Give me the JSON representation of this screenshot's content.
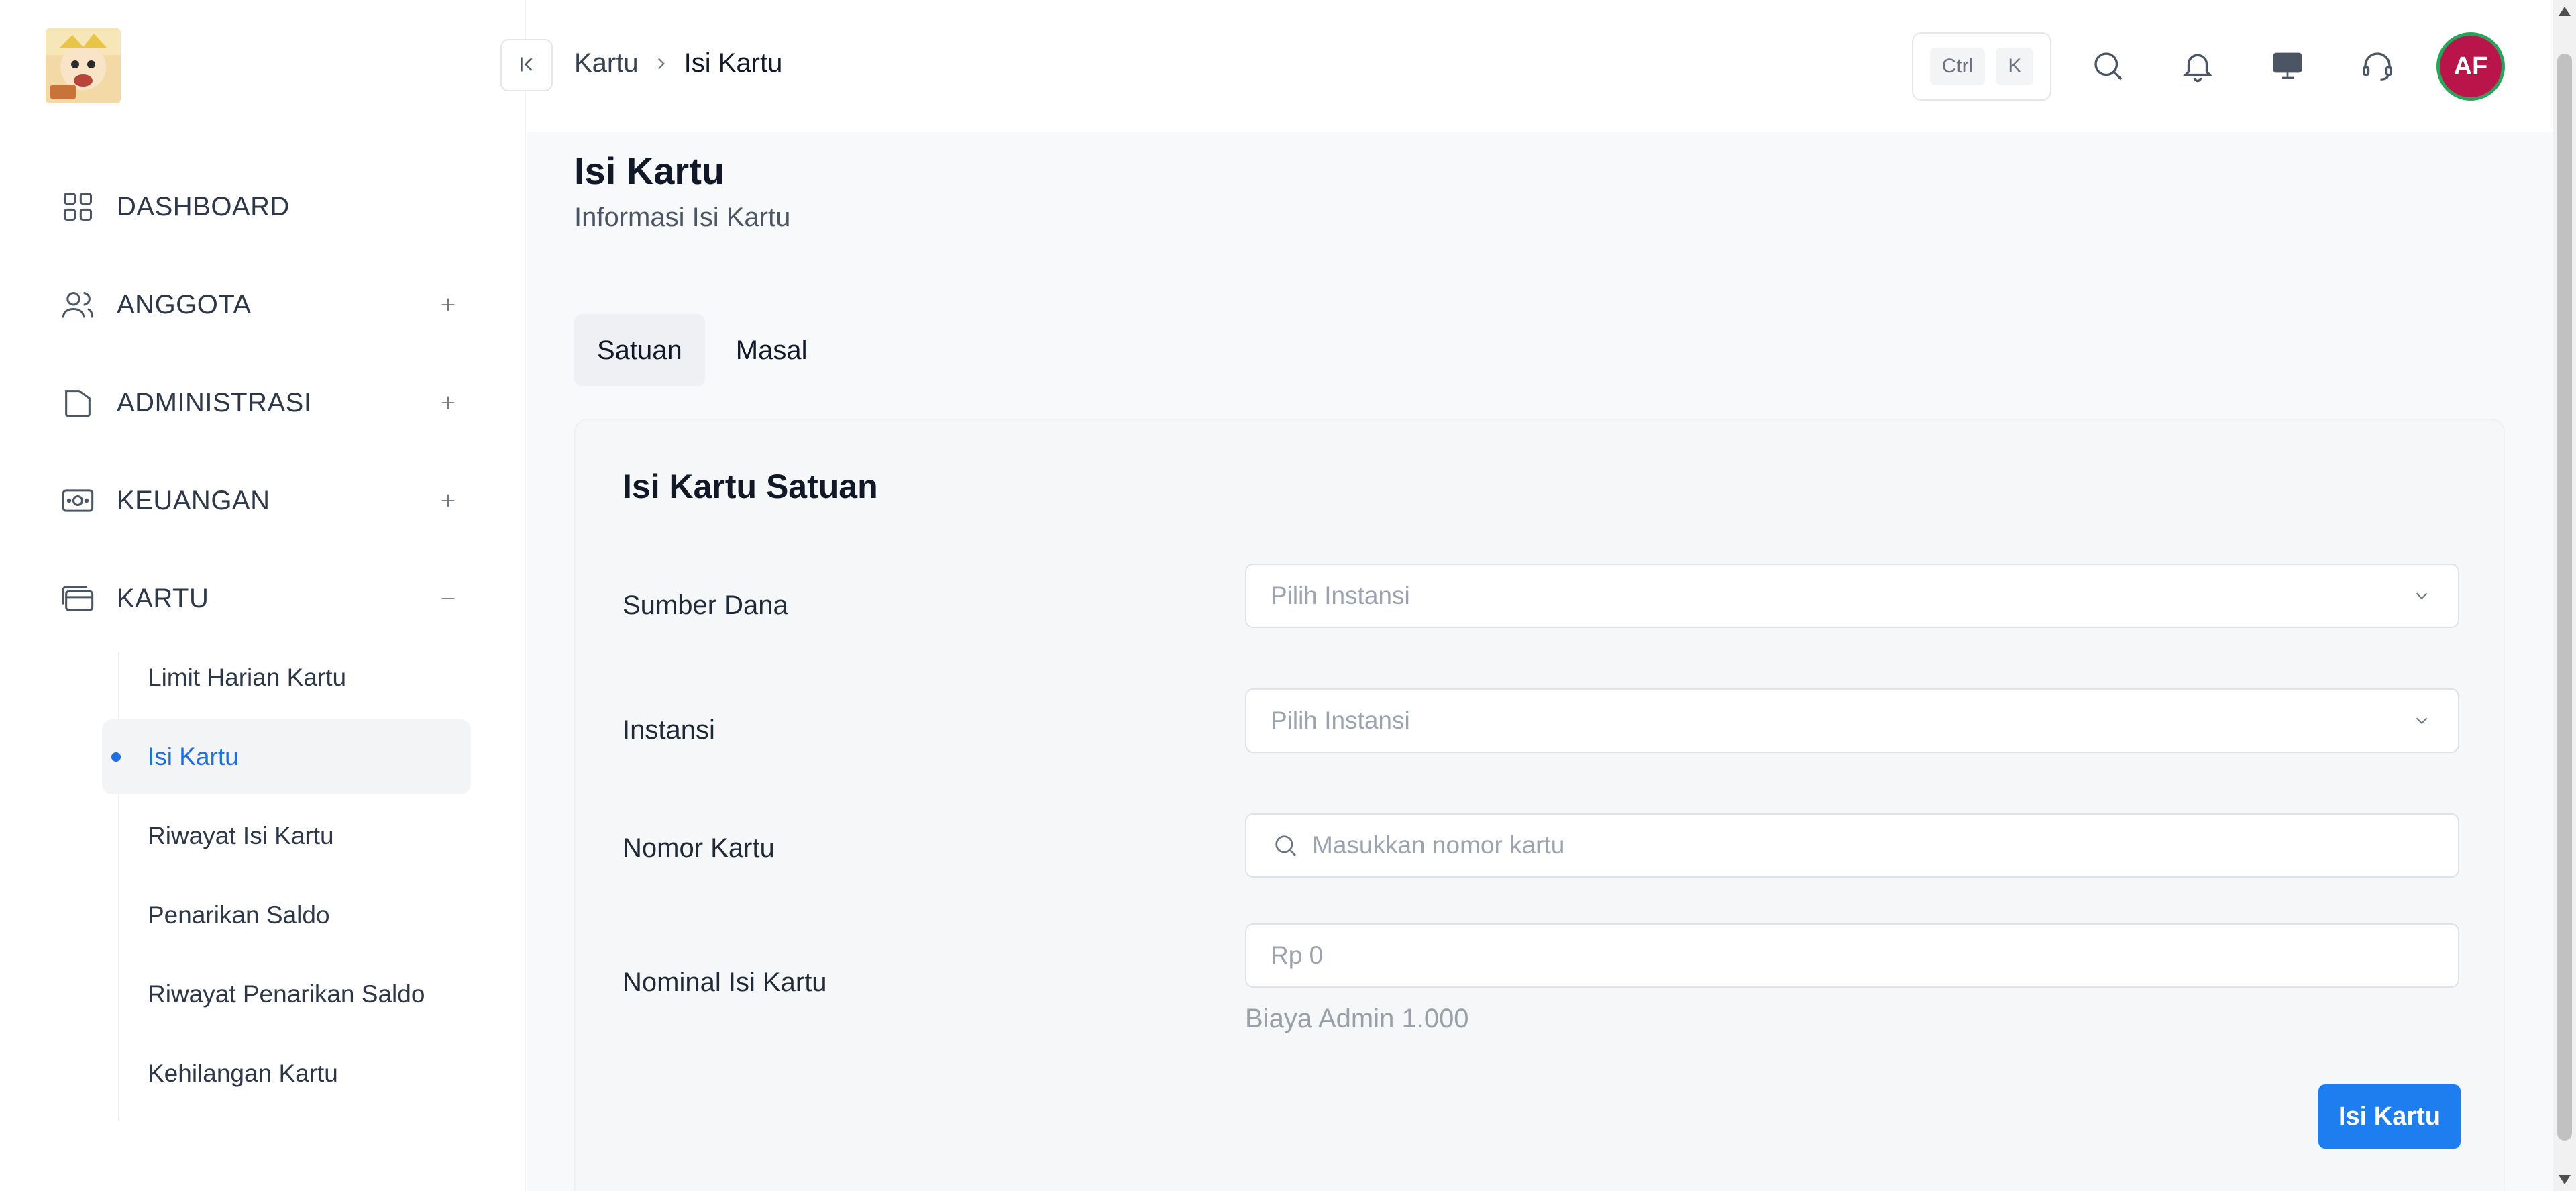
{
  "sidebar": {
    "items": [
      {
        "label": "DASHBOARD",
        "icon": "grid-icon"
      },
      {
        "label": "ANGGOTA",
        "icon": "users-icon",
        "toggle": "+"
      },
      {
        "label": "ADMINISTRASI",
        "icon": "folder-icon",
        "toggle": "+"
      },
      {
        "label": "KEUANGAN",
        "icon": "money-icon",
        "toggle": "+"
      },
      {
        "label": "KARTU",
        "icon": "card-icon",
        "toggle": "−"
      }
    ],
    "submenu": [
      {
        "label": "Limit Harian Kartu"
      },
      {
        "label": "Isi Kartu",
        "active": true
      },
      {
        "label": "Riwayat Isi Kartu"
      },
      {
        "label": "Penarikan Saldo"
      },
      {
        "label": "Riwayat Penarikan Saldo"
      },
      {
        "label": "Kehilangan Kartu"
      }
    ]
  },
  "header": {
    "breadcrumb": {
      "parent": "Kartu",
      "current": "Isi Kartu"
    },
    "shortcut": {
      "key1": "Ctrl",
      "key2": "K"
    },
    "avatar_initials": "AF",
    "accent_color": "#1e7ef0"
  },
  "page": {
    "title": "Isi Kartu",
    "subtitle": "Informasi Isi Kartu",
    "tabs": [
      {
        "label": "Satuan",
        "active": true
      },
      {
        "label": "Masal"
      }
    ]
  },
  "form": {
    "title": "Isi Kartu Satuan",
    "sumber_dana": {
      "label": "Sumber Dana",
      "placeholder": "Pilih Instansi"
    },
    "instansi": {
      "label": "Instansi",
      "placeholder": "Pilih Instansi"
    },
    "nomor_kartu": {
      "label": "Nomor Kartu",
      "placeholder": "Masukkan nomor kartu"
    },
    "nominal": {
      "label": "Nominal Isi Kartu",
      "placeholder": "Rp 0",
      "hint": "Biaya Admin 1.000"
    },
    "submit_label": "Isi Kartu"
  }
}
